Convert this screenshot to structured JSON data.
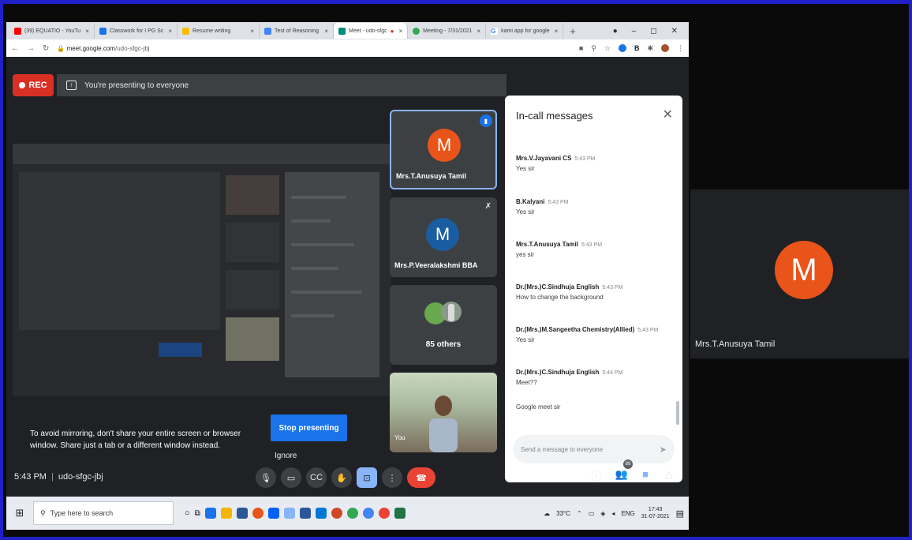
{
  "browser": {
    "tabs": [
      {
        "label": "(39) EQUATIO - YouTu",
        "color": "#ff0000"
      },
      {
        "label": "Classwork for I PG Sc",
        "color": "#1a73e8"
      },
      {
        "label": "Resume writing",
        "color": "#fbbc04"
      },
      {
        "label": "Test of Reasoning",
        "color": "#4285f4"
      },
      {
        "label": "Meet - udo-sfgc",
        "color": "#00897b",
        "active": true
      },
      {
        "label": "Meeting - 7/31/2021",
        "color": "#34a853"
      },
      {
        "label": "kami app for google",
        "color": "#4285f4"
      }
    ],
    "new_tab": "+",
    "url_host": "meet.google.com",
    "url_path": "/udo-sfgc-jbj"
  },
  "meet": {
    "rec_label": "REC",
    "presenting_text": "You're presenting to everyone",
    "warning_text": "To avoid mirroring, don't share your entire screen or browser window. Share just a tab or a different window instead.",
    "stop_presenting": "Stop presenting",
    "ignore": "Ignore",
    "time": "5:43 PM",
    "meeting_code": "udo-sfgc-jbj",
    "participant_count": "89"
  },
  "tiles": [
    {
      "initial": "M",
      "name": "Mrs.T.Anusuya Tamil"
    },
    {
      "initial": "M",
      "name": "Mrs.P.Veeralakshmi BBA"
    },
    {
      "name": "85 others"
    },
    {
      "name": "You"
    }
  ],
  "chat": {
    "title": "In-call messages",
    "messages": [
      {
        "sender": "Mrs.V.Jayavani CS",
        "time": "5:43 PM",
        "text": "Yes sir"
      },
      {
        "sender": "B.Kalyani",
        "time": "5:43 PM",
        "text": "Yes sir"
      },
      {
        "sender": "Mrs.T.Anusuya Tamil",
        "time": "5:43 PM",
        "text": "yes sir"
      },
      {
        "sender": "Dr.(Mrs.)C.Sindhuja English",
        "time": "5:43 PM",
        "text": "How to change the background"
      },
      {
        "sender": "Dr.(Mrs.)M.Sangeetha Chemistry(Allied)",
        "time": "5:43 PM",
        "text": "Yes sir"
      },
      {
        "sender": "Dr.(Mrs.)C.Sindhuja English",
        "time": "5:44 PM",
        "text": "Meet??"
      },
      {
        "sender": "",
        "time": "",
        "text": "Google meet sir"
      }
    ],
    "input_placeholder": "Send a message to everyone"
  },
  "taskbar": {
    "search_placeholder": "Type here to search",
    "weather": "33°C",
    "lang": "ENG",
    "clock_time": "17:43",
    "clock_date": "31-07-2021"
  },
  "side": {
    "initial": "M",
    "name": "Mrs.T.Anusuya Tamil"
  }
}
